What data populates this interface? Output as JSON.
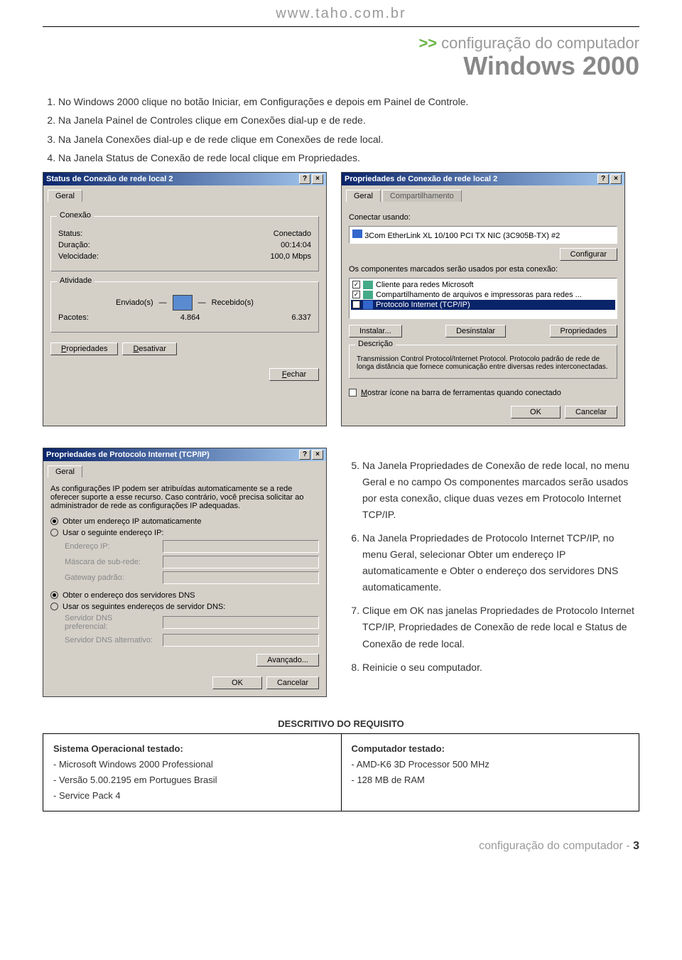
{
  "header": {
    "site": "www.taho.com.br"
  },
  "section": {
    "breadcrumb": "configuração do computador",
    "os": "Windows 2000"
  },
  "steps_a": [
    "No Windows 2000 clique no botão Iniciar, em Configurações e depois em Painel de Controle.",
    "Na Janela Painel de Controles clique em Conexões dial-up e de rede.",
    "Na Janela Conexões dial-up e de rede clique em Conexões de rede local.",
    "Na Janela Status de Conexão de rede local clique em Propriedades."
  ],
  "dlg1": {
    "title": "Status de Conexão de rede local 2",
    "tab": "Geral",
    "grp_conn": "Conexão",
    "status_l": "Status:",
    "status_v": "Conectado",
    "dur_l": "Duração:",
    "dur_v": "00:14:04",
    "spd_l": "Velocidade:",
    "spd_v": "100,0 Mbps",
    "grp_act": "Atividade",
    "sent": "Enviado(s)",
    "recv": "Recebido(s)",
    "pkt_l": "Pacotes:",
    "pkt_s": "4.864",
    "pkt_r": "6.337",
    "btn_props": "Propriedades",
    "btn_disable": "Desativar",
    "btn_close": "Fechar"
  },
  "dlg2": {
    "title": "Propriedades de Conexão de rede local 2",
    "tab1": "Geral",
    "tab2": "Compartilhamento",
    "connect_using": "Conectar usando:",
    "adapter": "3Com EtherLink XL 10/100 PCI TX NIC (3C905B-TX) #2",
    "btn_config": "Configurar",
    "comp_label": "Os componentes marcados serão usados por esta conexão:",
    "item1": "Cliente para redes Microsoft",
    "item2": "Compartilhamento de arquivos e impressoras para redes ...",
    "item3": "Protocolo Internet (TCP/IP)",
    "btn_install": "Instalar...",
    "btn_uninstall": "Desinstalar",
    "btn_props": "Propriedades",
    "desc_l": "Descrição",
    "desc": "Transmission Control Protocol/Internet Protocol. Protocolo padrão de rede de longa distância que fornece comunicação entre diversas redes interconectadas.",
    "show_icon": "Mostrar ícone na barra de ferramentas quando conectado",
    "btn_ok": "OK",
    "btn_cancel": "Cancelar"
  },
  "dlg3": {
    "title": "Propriedades de Protocolo Internet (TCP/IP)",
    "tab": "Geral",
    "intro": "As configurações IP podem ser atribuídas automaticamente se a rede oferecer suporte a esse recurso. Caso contrário, você precisa solicitar ao administrador de rede as configurações IP adequadas.",
    "opt_auto_ip": "Obter um endereço IP automaticamente",
    "opt_use_ip": "Usar o seguinte endereço IP:",
    "f_ip": "Endereço IP:",
    "f_mask": "Máscara de sub-rede:",
    "f_gw": "Gateway padrão:",
    "opt_auto_dns": "Obter o endereço dos servidores DNS",
    "opt_use_dns": "Usar os seguintes endereços de servidor DNS:",
    "f_dns1": "Servidor DNS preferencial:",
    "f_dns2": "Servidor DNS alternativo:",
    "btn_adv": "Avançado...",
    "btn_ok": "OK",
    "btn_cancel": "Cancelar"
  },
  "steps_b": [
    "Na Janela Propriedades de Conexão de rede local, no menu Geral e no campo Os componentes marcados serão usados por esta conexão, clique duas vezes em Protocolo Internet TCP/IP.",
    "Na Janela Propriedades de Protocolo Internet TCP/IP, no menu Geral, selecionar Obter um endereço IP automaticamente e Obter o endereço dos servidores DNS automaticamente.",
    "Clique em OK nas janelas Propriedades de Protocolo Internet TCP/IP, Propriedades de Conexão de rede local e Status de Conexão de rede local.",
    "Reinicie o seu computador."
  ],
  "req": {
    "title": "DESCRITIVO DO REQUISITO",
    "os_head": "Sistema Operacional testado:",
    "os_lines": [
      "- Microsoft Windows 2000 Professional",
      "- Versão 5.00.2195 em Portugues Brasil",
      "- Service Pack 4"
    ],
    "hw_head": "Computador testado:",
    "hw_lines": [
      "- AMD-K6 3D Processor 500 MHz",
      "- 128 MB de RAM"
    ]
  },
  "footer": {
    "label": "configuração do computador",
    "sep": " - ",
    "page": "3"
  }
}
